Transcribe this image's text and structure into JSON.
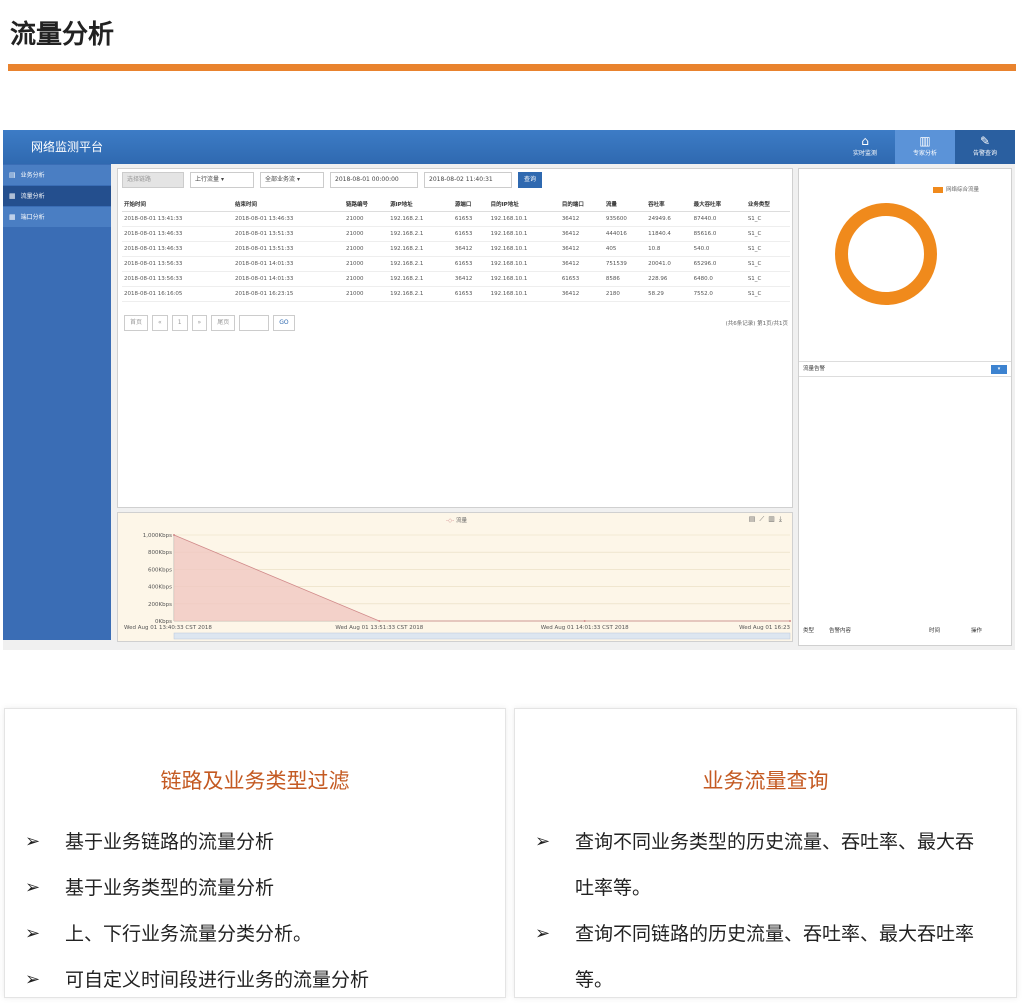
{
  "page": {
    "title": "流量分析"
  },
  "app": {
    "name": "网络监测平台",
    "top_tabs": [
      {
        "label": "实时监测",
        "icon": "home-icon",
        "active": false
      },
      {
        "label": "专家分析",
        "icon": "chart-icon",
        "active": true
      },
      {
        "label": "告警查询",
        "icon": "edit-icon",
        "active": false
      }
    ],
    "sidebar": [
      {
        "label": "业务分析",
        "icon": "document-icon",
        "active": false
      },
      {
        "label": "流量分析",
        "icon": "grid-icon",
        "active": true
      },
      {
        "label": "端口分析",
        "icon": "grid-icon",
        "active": false
      }
    ],
    "filters": {
      "link_placeholder": "选择链路",
      "direction": "上行流量",
      "service": "全部业务流",
      "start_time": "2018-08-01 00:00:00",
      "end_time": "2018-08-02 11:40:31",
      "search_label": "查询"
    },
    "table": {
      "columns": [
        "开始时间",
        "结束时间",
        "链路编号",
        "源IP地址",
        "源端口",
        "目的IP地址",
        "目的端口",
        "流量",
        "吞吐率",
        "最大吞吐率",
        "业务类型"
      ],
      "rows": [
        [
          "2018-08-01 13:41:33",
          "2018-08-01 13:46:33",
          "21000",
          "192.168.2.1",
          "61653",
          "192.168.10.1",
          "36412",
          "935600",
          "24949.6",
          "87440.0",
          "S1_C"
        ],
        [
          "2018-08-01 13:46:33",
          "2018-08-01 13:51:33",
          "21000",
          "192.168.2.1",
          "61653",
          "192.168.10.1",
          "36412",
          "444016",
          "11840.4",
          "85616.0",
          "S1_C"
        ],
        [
          "2018-08-01 13:46:33",
          "2018-08-01 13:51:33",
          "21000",
          "192.168.2.1",
          "36412",
          "192.168.10.1",
          "36412",
          "405",
          "10.8",
          "540.0",
          "S1_C"
        ],
        [
          "2018-08-01 13:56:33",
          "2018-08-01 14:01:33",
          "21000",
          "192.168.2.1",
          "61653",
          "192.168.10.1",
          "36412",
          "751539",
          "20041.0",
          "65296.0",
          "S1_C"
        ],
        [
          "2018-08-01 13:56:33",
          "2018-08-01 14:01:33",
          "21000",
          "192.168.2.1",
          "36412",
          "192.168.10.1",
          "61653",
          "8586",
          "228.96",
          "6480.0",
          "S1_C"
        ],
        [
          "2018-08-01 16:16:05",
          "2018-08-01 16:23:15",
          "21000",
          "192.168.2.1",
          "61653",
          "192.168.10.1",
          "36412",
          "2180",
          "58.29",
          "7552.0",
          "S1_C"
        ]
      ]
    },
    "pager": {
      "first": "首页",
      "prev": "«",
      "page": "1",
      "next": "»",
      "last": "尾页",
      "go": "GO",
      "info": "(共6条记录) 第1页/共1页"
    },
    "pie": {
      "legend": "网络综合流量",
      "color": "#f08a1c"
    },
    "alarm": {
      "title": "流量告警",
      "columns": [
        "类型",
        "告警内容",
        "时间",
        "操作"
      ]
    }
  },
  "chart_data": {
    "type": "area",
    "legend": "流量",
    "x": [
      "Wed Aug 01 13:40:33 CST 2018",
      "Wed Aug 01 13:51:33 CST 2018",
      "Wed Aug 01 14:01:33 CST 2018",
      "Wed Aug 01 16:23"
    ],
    "y_ticks": [
      "1,000Kbps",
      "800Kbps",
      "600Kbps",
      "400Kbps",
      "200Kbps",
      "0Kbps"
    ],
    "series": [
      {
        "name": "流量",
        "values": [
          1000,
          0,
          0,
          0
        ]
      }
    ],
    "ylim": [
      0,
      1000
    ],
    "fill": "#f0c8c0",
    "line": "#d08a8a",
    "background": "#fdf6e8"
  },
  "cards": [
    {
      "title": "链路及业务类型过滤",
      "items": [
        "基于业务链路的流量分析",
        "基于业务类型的流量分析",
        "上、下行业务流量分类分析。",
        "可自定义时间段进行业务的流量分析"
      ]
    },
    {
      "title": "业务流量查询",
      "items": [
        "查询不同业务类型的历史流量、吞吐率、最大吞吐率等。",
        "查询不同链路的历史流量、吞吐率、最大吞吐率等。"
      ]
    }
  ],
  "colors": {
    "accent": "#e9832e",
    "header_blue": "#2f69b0",
    "card_title": "#c45a22"
  }
}
